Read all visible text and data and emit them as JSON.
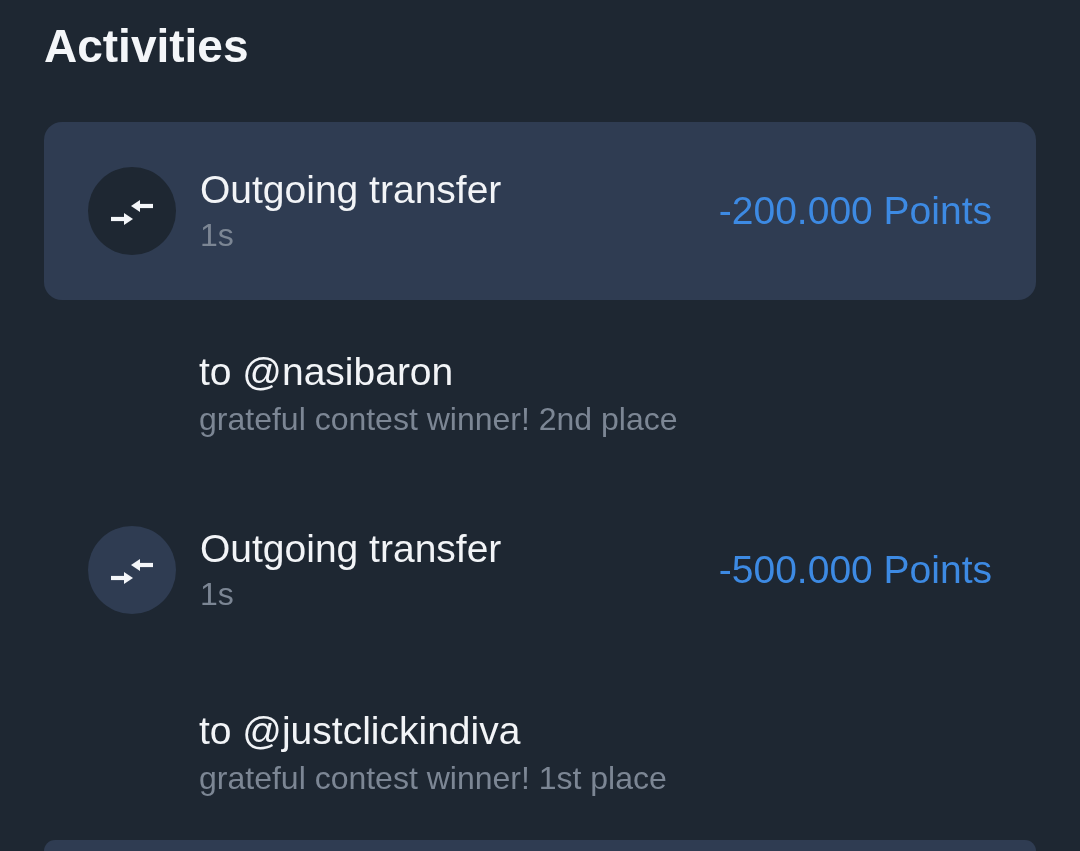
{
  "title": "Activities",
  "activities": [
    {
      "kind": "transfer",
      "selected": true,
      "title": "Outgoing transfer",
      "time": "1s",
      "amount": "-200.000 Points",
      "recipient": "to @nasibaron",
      "note": "grateful contest winner! 2nd place"
    },
    {
      "kind": "transfer",
      "selected": false,
      "title": "Outgoing transfer",
      "time": "1s",
      "amount": "-500.000 Points",
      "recipient": "to @justclickindiva",
      "note": "grateful contest winner! 1st place"
    },
    {
      "kind": "clipped",
      "selected": true
    }
  ]
}
